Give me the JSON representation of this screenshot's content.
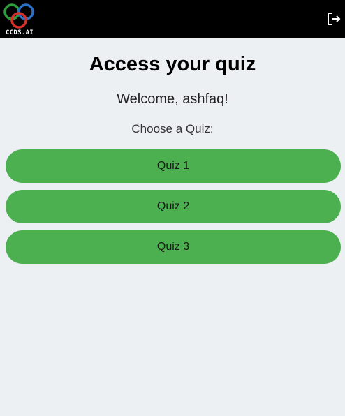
{
  "header": {
    "logo_text": "CCDS.AI",
    "logout_icon": "logout-icon"
  },
  "main": {
    "title": "Access your quiz",
    "welcome": "Welcome, ashfaq!",
    "choose_label": "Choose a Quiz:",
    "quizzes": [
      {
        "label": "Quiz 1"
      },
      {
        "label": "Quiz 2"
      },
      {
        "label": "Quiz 3"
      }
    ]
  },
  "colors": {
    "header_bg": "#000000",
    "page_bg": "#edf0f3",
    "button_bg": "#4caf50",
    "logo_green": "#2e9e3c",
    "logo_red": "#d9302a",
    "logo_blue": "#2b6fc7"
  }
}
